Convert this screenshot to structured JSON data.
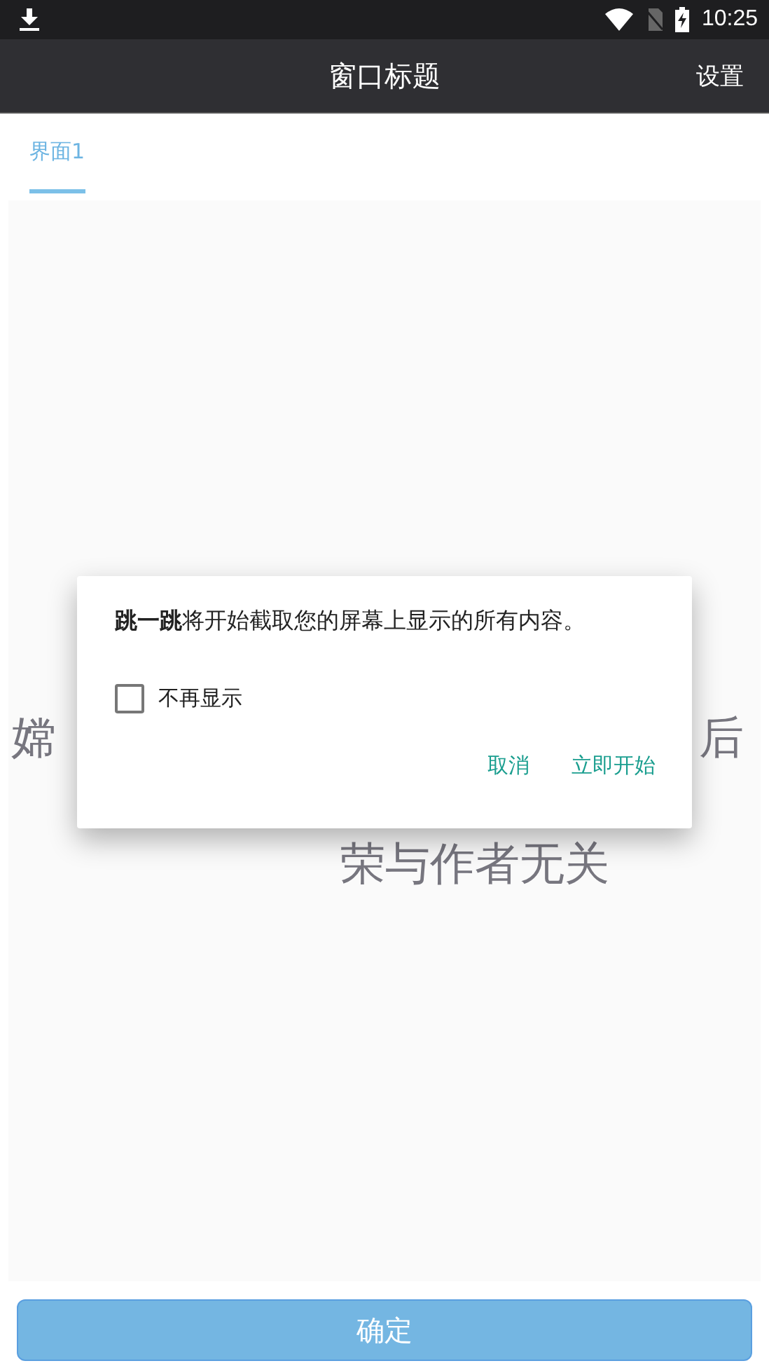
{
  "status_bar": {
    "time": "10:25"
  },
  "app_bar": {
    "title": "窗口标题",
    "action": "设置"
  },
  "tabs": [
    {
      "label": "界面1",
      "selected": true
    }
  ],
  "background_text": {
    "line_1_left": "嫦",
    "line_1_right": "后",
    "line_2": "荣与作者无关"
  },
  "dialog": {
    "message": "**跳一跳**将开始截取您的屏幕上显示的所有内容。",
    "checkbox": {
      "label": "不再显示",
      "checked": false
    },
    "buttons": [
      "取消",
      "立即开始"
    ]
  },
  "confirm_button": "确定"
}
